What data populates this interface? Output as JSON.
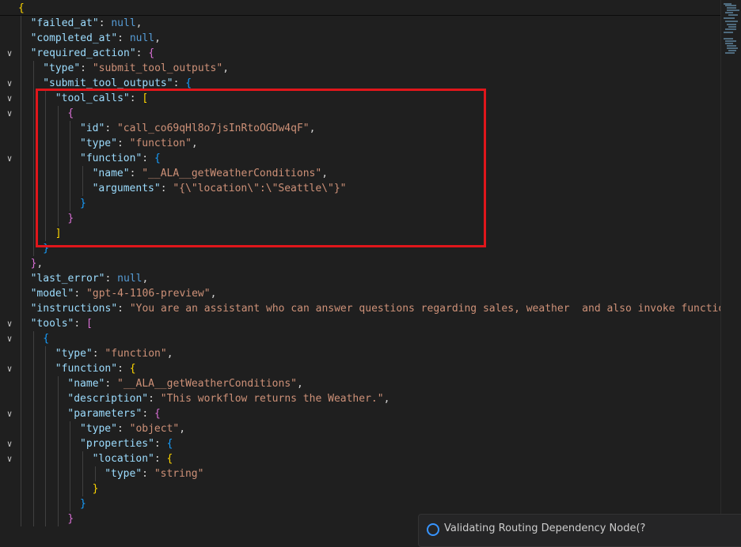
{
  "colors": {
    "key": "#9cdcfe",
    "string": "#ce9178",
    "null": "#569cd6",
    "bracket1": "#ffd700",
    "bracket2": "#da70d6",
    "bracket3": "#179fff",
    "highlight": "#e0161b"
  },
  "code": {
    "lines": [
      {
        "i": 0,
        "f": false,
        "t": [
          [
            "b1",
            "{"
          ]
        ]
      },
      {
        "i": 1,
        "f": false,
        "t": [
          [
            "k",
            "\"failed_at\""
          ],
          [
            "p",
            ": "
          ],
          [
            "n",
            "null"
          ],
          [
            "p",
            ","
          ]
        ]
      },
      {
        "i": 1,
        "f": false,
        "t": [
          [
            "k",
            "\"completed_at\""
          ],
          [
            "p",
            ": "
          ],
          [
            "n",
            "null"
          ],
          [
            "p",
            ","
          ]
        ]
      },
      {
        "i": 1,
        "f": true,
        "t": [
          [
            "k",
            "\"required_action\""
          ],
          [
            "p",
            ": "
          ],
          [
            "b2",
            "{"
          ]
        ]
      },
      {
        "i": 2,
        "f": false,
        "t": [
          [
            "k",
            "\"type\""
          ],
          [
            "p",
            ": "
          ],
          [
            "s",
            "\"submit_tool_outputs\""
          ],
          [
            "p",
            ","
          ]
        ]
      },
      {
        "i": 2,
        "f": true,
        "t": [
          [
            "k",
            "\"submit_tool_outputs\""
          ],
          [
            "p",
            ": "
          ],
          [
            "b3",
            "{"
          ]
        ]
      },
      {
        "i": 3,
        "f": true,
        "t": [
          [
            "k",
            "\"tool_calls\""
          ],
          [
            "p",
            ": "
          ],
          [
            "b1",
            "["
          ]
        ]
      },
      {
        "i": 4,
        "f": true,
        "t": [
          [
            "b2",
            "{"
          ]
        ]
      },
      {
        "i": 5,
        "f": false,
        "t": [
          [
            "k",
            "\"id\""
          ],
          [
            "p",
            ": "
          ],
          [
            "s",
            "\"call_co69qHl8o7jsInRtoOGDw4qF\""
          ],
          [
            "p",
            ","
          ]
        ]
      },
      {
        "i": 5,
        "f": false,
        "t": [
          [
            "k",
            "\"type\""
          ],
          [
            "p",
            ": "
          ],
          [
            "s",
            "\"function\""
          ],
          [
            "p",
            ","
          ]
        ]
      },
      {
        "i": 5,
        "f": true,
        "t": [
          [
            "k",
            "\"function\""
          ],
          [
            "p",
            ": "
          ],
          [
            "b3",
            "{"
          ]
        ]
      },
      {
        "i": 6,
        "f": false,
        "t": [
          [
            "k",
            "\"name\""
          ],
          [
            "p",
            ": "
          ],
          [
            "s",
            "\"__ALA__getWeatherConditions\""
          ],
          [
            "p",
            ","
          ]
        ]
      },
      {
        "i": 6,
        "f": false,
        "t": [
          [
            "k",
            "\"arguments\""
          ],
          [
            "p",
            ": "
          ],
          [
            "s",
            "\"{\\\"location\\\":\\\"Seattle\\\"}\""
          ]
        ]
      },
      {
        "i": 5,
        "f": false,
        "t": [
          [
            "b3",
            "}"
          ]
        ]
      },
      {
        "i": 4,
        "f": false,
        "t": [
          [
            "b2",
            "}"
          ]
        ]
      },
      {
        "i": 3,
        "f": false,
        "t": [
          [
            "b1",
            "]"
          ]
        ]
      },
      {
        "i": 2,
        "f": false,
        "t": [
          [
            "b3",
            "}"
          ]
        ]
      },
      {
        "i": 1,
        "f": false,
        "t": [
          [
            "b2",
            "}"
          ],
          [
            "p",
            ","
          ]
        ]
      },
      {
        "i": 1,
        "f": false,
        "t": [
          [
            "k",
            "\"last_error\""
          ],
          [
            "p",
            ": "
          ],
          [
            "n",
            "null"
          ],
          [
            "p",
            ","
          ]
        ]
      },
      {
        "i": 1,
        "f": false,
        "t": [
          [
            "k",
            "\"model\""
          ],
          [
            "p",
            ": "
          ],
          [
            "s",
            "\"gpt-4-1106-preview\""
          ],
          [
            "p",
            ","
          ]
        ]
      },
      {
        "i": 1,
        "f": false,
        "t": [
          [
            "k",
            "\"instructions\""
          ],
          [
            "p",
            ": "
          ],
          [
            "s",
            "\"You are an assistant who can answer questions regarding sales, weather  and also invoke function"
          ]
        ]
      },
      {
        "i": 1,
        "f": true,
        "t": [
          [
            "k",
            "\"tools\""
          ],
          [
            "p",
            ": "
          ],
          [
            "b2",
            "["
          ]
        ]
      },
      {
        "i": 2,
        "f": true,
        "t": [
          [
            "b3",
            "{"
          ]
        ]
      },
      {
        "i": 3,
        "f": false,
        "t": [
          [
            "k",
            "\"type\""
          ],
          [
            "p",
            ": "
          ],
          [
            "s",
            "\"function\""
          ],
          [
            "p",
            ","
          ]
        ]
      },
      {
        "i": 3,
        "f": true,
        "t": [
          [
            "k",
            "\"function\""
          ],
          [
            "p",
            ": "
          ],
          [
            "b1",
            "{"
          ]
        ]
      },
      {
        "i": 4,
        "f": false,
        "t": [
          [
            "k",
            "\"name\""
          ],
          [
            "p",
            ": "
          ],
          [
            "s",
            "\"__ALA__getWeatherConditions\""
          ],
          [
            "p",
            ","
          ]
        ]
      },
      {
        "i": 4,
        "f": false,
        "t": [
          [
            "k",
            "\"description\""
          ],
          [
            "p",
            ": "
          ],
          [
            "s",
            "\"This workflow returns the Weather.\""
          ],
          [
            "p",
            ","
          ]
        ]
      },
      {
        "i": 4,
        "f": true,
        "t": [
          [
            "k",
            "\"parameters\""
          ],
          [
            "p",
            ": "
          ],
          [
            "b2",
            "{"
          ]
        ]
      },
      {
        "i": 5,
        "f": false,
        "t": [
          [
            "k",
            "\"type\""
          ],
          [
            "p",
            ": "
          ],
          [
            "s",
            "\"object\""
          ],
          [
            "p",
            ","
          ]
        ]
      },
      {
        "i": 5,
        "f": true,
        "t": [
          [
            "k",
            "\"properties\""
          ],
          [
            "p",
            ": "
          ],
          [
            "b3",
            "{"
          ]
        ]
      },
      {
        "i": 6,
        "f": true,
        "t": [
          [
            "k",
            "\"location\""
          ],
          [
            "p",
            ": "
          ],
          [
            "b1",
            "{"
          ]
        ]
      },
      {
        "i": 7,
        "f": false,
        "t": [
          [
            "k",
            "\"type\""
          ],
          [
            "p",
            ": "
          ],
          [
            "s",
            "\"string\""
          ]
        ]
      },
      {
        "i": 6,
        "f": false,
        "t": [
          [
            "b1",
            "}"
          ]
        ]
      },
      {
        "i": 5,
        "f": false,
        "t": [
          [
            "b3",
            "}"
          ]
        ]
      },
      {
        "i": 4,
        "f": false,
        "t": [
          [
            "b2",
            "}"
          ]
        ]
      }
    ]
  },
  "notification": {
    "icon": "info-icon",
    "text": "Validating Routing Dependency Node(?"
  }
}
